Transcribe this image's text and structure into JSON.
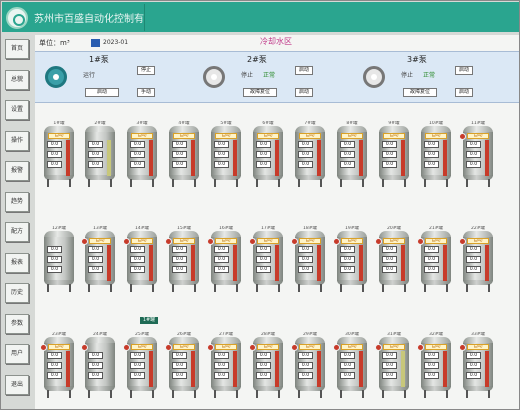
{
  "header": {
    "company": "苏州市百盛自动化控制有限公司"
  },
  "sidebar": {
    "items": [
      "首页",
      "总貌",
      "设置",
      "操作",
      "报警",
      "趋势",
      "配方",
      "报表",
      "历史",
      "参数",
      "用户",
      "退出"
    ]
  },
  "main": {
    "shuju_label": "单位：m³",
    "shuju_value": "2023-01",
    "area_title": "冷却水区",
    "pumps": [
      {
        "name": "1#泵",
        "status_label": "运行",
        "status_value": "",
        "btn_top": "停止",
        "btn_mid": "自动",
        "btn_bot": "启动",
        "btn_small": "手动"
      },
      {
        "name": "2#泵",
        "status_label": "停止",
        "status_value": "正常",
        "btn_top": "启动",
        "btn_mid": "",
        "btn_bot": "故障复位",
        "btn_small": "启动"
      },
      {
        "name": "3#泵",
        "status_label": "停止",
        "status_value": "正常",
        "btn_top": "启动",
        "btn_mid": "",
        "btn_bot": "故障复位",
        "btn_small": "启动"
      }
    ],
    "badge": "1#罐",
    "tanks": [
      {
        "tag": "1#罐",
        "alarm": false,
        "label": "自动",
        "v1": "0.0",
        "v2": "0.0",
        "v3": "0.0",
        "level": "red"
      },
      {
        "tag": "2#罐",
        "alarm": false,
        "label": "",
        "v1": "0.0",
        "v2": "0.0",
        "v3": "0.0",
        "level": "yellow"
      },
      {
        "tag": "3#罐",
        "alarm": false,
        "label": "自动",
        "v1": "0.0",
        "v2": "0.0",
        "v3": "0.0",
        "level": "red"
      },
      {
        "tag": "4#罐",
        "alarm": false,
        "label": "自动",
        "v1": "0.0",
        "v2": "0.0",
        "v3": "0.0",
        "level": "red"
      },
      {
        "tag": "5#罐",
        "alarm": false,
        "label": "自动",
        "v1": "0.0",
        "v2": "0.0",
        "v3": "0.0",
        "level": "red"
      },
      {
        "tag": "6#罐",
        "alarm": false,
        "label": "自动",
        "v1": "0.0",
        "v2": "0.0",
        "v3": "0.0",
        "level": "red"
      },
      {
        "tag": "7#罐",
        "alarm": false,
        "label": "自动",
        "v1": "0.0",
        "v2": "0.0",
        "v3": "0.0",
        "level": "red"
      },
      {
        "tag": "8#罐",
        "alarm": false,
        "label": "自动",
        "v1": "0.0",
        "v2": "0.0",
        "v3": "0.0",
        "level": "red"
      },
      {
        "tag": "9#罐",
        "alarm": false,
        "label": "自动",
        "v1": "0.0",
        "v2": "0.0",
        "v3": "0.0",
        "level": "red"
      },
      {
        "tag": "10#罐",
        "alarm": false,
        "label": "自动",
        "v1": "0.0",
        "v2": "0.0",
        "v3": "0.0",
        "level": "red"
      },
      {
        "tag": "11#罐",
        "alarm": true,
        "label": "自动",
        "v1": "0.0",
        "v2": "0.0",
        "v3": "0.0",
        "level": "red"
      },
      {
        "tag": "12#罐",
        "alarm": false,
        "label": "",
        "v1": "0.0",
        "v2": "0.0",
        "v3": "0.0",
        "level": "none"
      },
      {
        "tag": "13#罐",
        "alarm": true,
        "label": "自动",
        "v1": "0.0",
        "v2": "0.0",
        "v3": "0.0",
        "level": "red"
      },
      {
        "tag": "14#罐",
        "alarm": true,
        "label": "自动",
        "v1": "0.0",
        "v2": "0.0",
        "v3": "0.0",
        "level": "red"
      },
      {
        "tag": "15#罐",
        "alarm": true,
        "label": "自动",
        "v1": "0.0",
        "v2": "0.0",
        "v3": "0.0",
        "level": "red"
      },
      {
        "tag": "16#罐",
        "alarm": true,
        "label": "自动",
        "v1": "0.0",
        "v2": "0.0",
        "v3": "0.0",
        "level": "red"
      },
      {
        "tag": "17#罐",
        "alarm": true,
        "label": "自动",
        "v1": "0.0",
        "v2": "0.0",
        "v3": "0.0",
        "level": "red"
      },
      {
        "tag": "18#罐",
        "alarm": true,
        "label": "自动",
        "v1": "0.0",
        "v2": "0.0",
        "v3": "0.0",
        "level": "red"
      },
      {
        "tag": "19#罐",
        "alarm": true,
        "label": "自动",
        "v1": "0.0",
        "v2": "0.0",
        "v3": "0.0",
        "level": "red"
      },
      {
        "tag": "20#罐",
        "alarm": true,
        "label": "自动",
        "v1": "0.0",
        "v2": "0.0",
        "v3": "0.0",
        "level": "red"
      },
      {
        "tag": "21#罐",
        "alarm": true,
        "label": "自动",
        "v1": "0.0",
        "v2": "0.0",
        "v3": "0.0",
        "level": "red"
      },
      {
        "tag": "22#罐",
        "alarm": true,
        "label": "自动",
        "v1": "0.0",
        "v2": "0.0",
        "v3": "0.0",
        "level": "red"
      },
      {
        "tag": "23#罐",
        "alarm": true,
        "label": "自动",
        "v1": "0.0",
        "v2": "0.0",
        "v3": "0.0",
        "level": "red"
      },
      {
        "tag": "24#罐",
        "alarm": true,
        "label": "",
        "v1": "0.0",
        "v2": "0.0",
        "v3": "0.0",
        "level": "none"
      },
      {
        "tag": "25#罐",
        "alarm": true,
        "label": "自动",
        "v1": "0.0",
        "v2": "0.0",
        "v3": "0.0",
        "level": "red"
      },
      {
        "tag": "26#罐",
        "alarm": true,
        "label": "自动",
        "v1": "0.0",
        "v2": "0.0",
        "v3": "0.0",
        "level": "red"
      },
      {
        "tag": "27#罐",
        "alarm": true,
        "label": "自动",
        "v1": "0.0",
        "v2": "0.0",
        "v3": "0.0",
        "level": "red"
      },
      {
        "tag": "28#罐",
        "alarm": true,
        "label": "自动",
        "v1": "0.0",
        "v2": "0.0",
        "v3": "0.0",
        "level": "red"
      },
      {
        "tag": "29#罐",
        "alarm": true,
        "label": "自动",
        "v1": "0.0",
        "v2": "0.0",
        "v3": "0.0",
        "level": "red"
      },
      {
        "tag": "30#罐",
        "alarm": true,
        "label": "自动",
        "v1": "0.0",
        "v2": "0.0",
        "v3": "0.0",
        "level": "red"
      },
      {
        "tag": "31#罐",
        "alarm": true,
        "label": "自动",
        "v1": "0.0",
        "v2": "0.0",
        "v3": "0.0",
        "level": "yellow"
      },
      {
        "tag": "32#罐",
        "alarm": true,
        "label": "自动",
        "v1": "0.0",
        "v2": "0.0",
        "v3": "0.0",
        "level": "red"
      },
      {
        "tag": "33#罐",
        "alarm": true,
        "label": "自动",
        "v1": "0.0",
        "v2": "0.0",
        "v3": "0.0",
        "level": "red"
      }
    ]
  }
}
